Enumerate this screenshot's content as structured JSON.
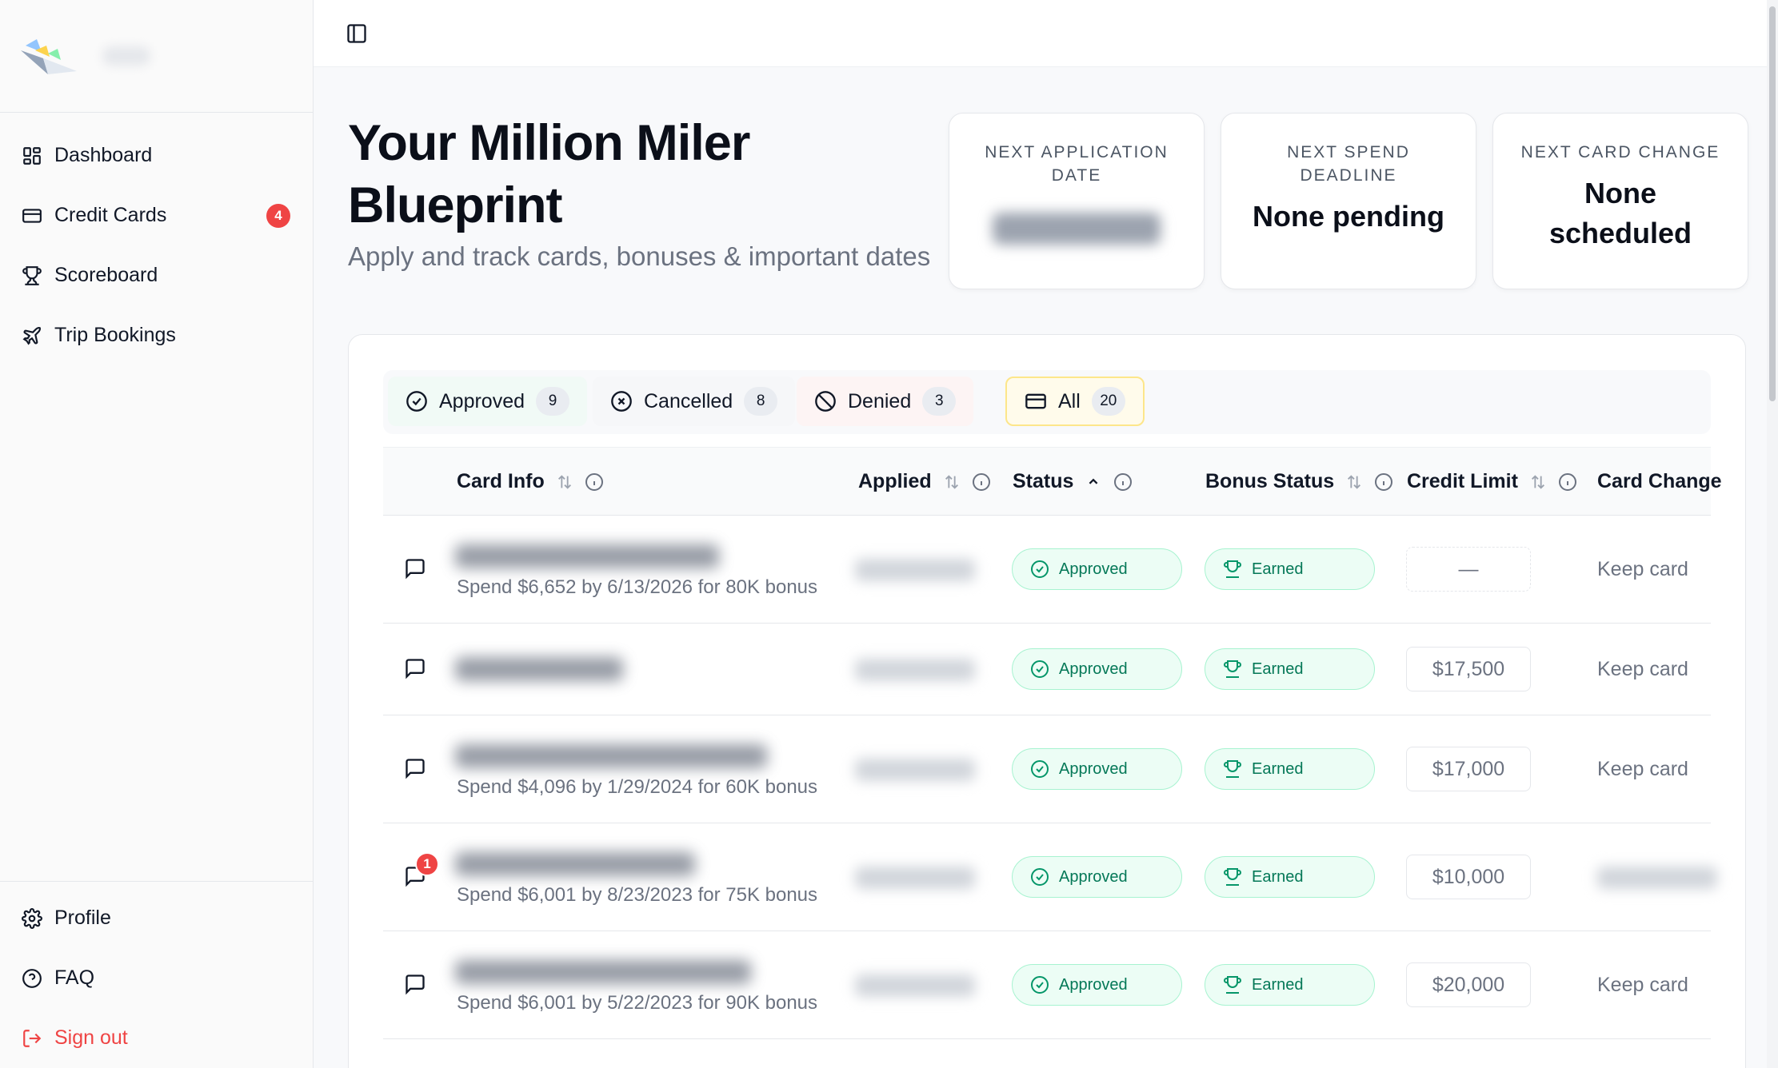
{
  "sidebar": {
    "items": [
      {
        "label": "Dashboard",
        "icon": "dashboard-icon"
      },
      {
        "label": "Credit Cards",
        "icon": "credit-card-icon",
        "badge": "4"
      },
      {
        "label": "Scoreboard",
        "icon": "trophy-icon"
      },
      {
        "label": "Trip Bookings",
        "icon": "plane-icon"
      }
    ],
    "bottom": [
      {
        "label": "Profile",
        "icon": "gear-icon"
      },
      {
        "label": "FAQ",
        "icon": "help-circle-icon"
      },
      {
        "label": "Sign out",
        "icon": "sign-out-icon"
      }
    ]
  },
  "header": {
    "title": "Your Million Miler Blueprint",
    "subtitle": "Apply and track cards, bonuses & important dates"
  },
  "stats": [
    {
      "label": "NEXT APPLICATION DATE",
      "value": ""
    },
    {
      "label": "NEXT SPEND DEADLINE",
      "value": "None pending"
    },
    {
      "label": "NEXT CARD CHANGE",
      "value": "None scheduled"
    }
  ],
  "filters": [
    {
      "label": "Approved",
      "count": "9"
    },
    {
      "label": "Cancelled",
      "count": "8"
    },
    {
      "label": "Denied",
      "count": "3"
    },
    {
      "label": "All",
      "count": "20"
    }
  ],
  "table": {
    "columns": {
      "card_info": "Card Info",
      "applied": "Applied",
      "status": "Status",
      "bonus_status": "Bonus Status",
      "credit_limit": "Credit Limit",
      "card_change": "Card Change"
    },
    "rows": [
      {
        "spend": "Spend $6,652 by 6/13/2026 for 80K bonus",
        "status": "Approved",
        "bonus": "Earned",
        "limit": "—",
        "change": "Keep card",
        "comments": ""
      },
      {
        "spend": "",
        "status": "Approved",
        "bonus": "Earned",
        "limit": "$17,500",
        "change": "Keep card",
        "comments": ""
      },
      {
        "spend": "Spend $4,096 by 1/29/2024 for 60K bonus",
        "status": "Approved",
        "bonus": "Earned",
        "limit": "$17,000",
        "change": "Keep card",
        "comments": ""
      },
      {
        "spend": "Spend $6,001 by 8/23/2023 for 75K bonus",
        "status": "Approved",
        "bonus": "Earned",
        "limit": "$10,000",
        "change": "",
        "comments": "1"
      },
      {
        "spend": "Spend $6,001 by 5/22/2023 for 90K bonus",
        "status": "Approved",
        "bonus": "Earned",
        "limit": "$20,000",
        "change": "Keep card",
        "comments": ""
      }
    ]
  }
}
